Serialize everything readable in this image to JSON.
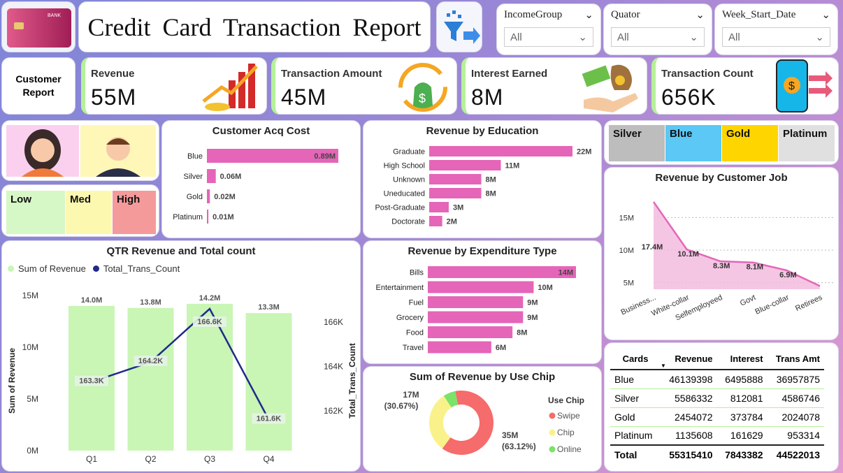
{
  "title": "Credit Card Transaction Report",
  "nav_label": "Customer Report",
  "slicers": [
    {
      "label": "IncomeGroup",
      "value": "All"
    },
    {
      "label": "Quator",
      "value": "All"
    },
    {
      "label": "Week_Start_Date",
      "value": "All"
    }
  ],
  "kpis": [
    {
      "label": "Revenue",
      "value": "55M"
    },
    {
      "label": "Transaction Amount",
      "value": "45M"
    },
    {
      "label": "Interest Earned",
      "value": "8M"
    },
    {
      "label": "Transaction Count",
      "value": "656K"
    }
  ],
  "tiers": [
    "Silver",
    "Blue",
    "Gold",
    "Platinum"
  ],
  "risk": [
    "Low",
    "Med",
    "High"
  ],
  "colors": {
    "pink": "#e565b8",
    "green": "#c9f5b5",
    "navy": "#1f2a8a",
    "silver": "#bdbdbd",
    "blue": "#5bc8f5",
    "gold": "#ffd500",
    "platinum": "#e0e0e0",
    "low": "#d6f7c6",
    "med": "#fdf8b0",
    "high": "#f59a9a"
  },
  "charts": {
    "acq": {
      "title": "Customer Acq Cost",
      "categories": [
        "Blue",
        "Silver",
        "Gold",
        "Platinum"
      ],
      "values": [
        0.89,
        0.06,
        0.02,
        0.01
      ],
      "labels": [
        "0.89M",
        "0.06M",
        "0.02M",
        "0.01M"
      ]
    },
    "edu": {
      "title": "Revenue by Education",
      "categories": [
        "Graduate",
        "High School",
        "Unknown",
        "Uneducated",
        "Post-Graduate",
        "Doctorate"
      ],
      "values": [
        22,
        11,
        8,
        8,
        3,
        2
      ],
      "labels": [
        "22M",
        "11M",
        "8M",
        "8M",
        "3M",
        "2M"
      ]
    },
    "exp": {
      "title": "Revenue by Expenditure Type",
      "categories": [
        "Bills",
        "Entertainment",
        "Fuel",
        "Grocery",
        "Food",
        "Travel"
      ],
      "values": [
        14,
        10,
        9,
        9,
        8,
        6
      ],
      "labels": [
        "14M",
        "10M",
        "9M",
        "9M",
        "8M",
        "6M"
      ]
    },
    "job": {
      "title": "Revenue by Customer Job",
      "categories": [
        "Business...",
        "White-collar",
        "Selfemployeed",
        "Govt",
        "Blue-collar",
        "Retirees"
      ],
      "values": [
        17.4,
        10.1,
        8.3,
        8.1,
        6.9,
        4.5
      ],
      "labels": [
        "17.4M",
        "10.1M",
        "8.3M",
        "8.1M",
        "6.9M",
        ""
      ],
      "yticks": [
        "15M",
        "10M",
        "5M"
      ]
    },
    "qtr": {
      "title": "QTR Revenue and Total count",
      "legend": [
        "Sum of Revenue",
        "Total_Trans_Count"
      ],
      "categories": [
        "Q1",
        "Q2",
        "Q3",
        "Q4"
      ],
      "revenue": [
        14.0,
        13.8,
        14.2,
        13.3
      ],
      "rev_labels": [
        "14.0M",
        "13.8M",
        "14.2M",
        "13.3M"
      ],
      "count": [
        163.3,
        164.2,
        166.6,
        161.6
      ],
      "count_labels": [
        "163.3K",
        "164.2K",
        "166.6K",
        "161.6K"
      ],
      "ylabel": "Sum of Revenue",
      "y2label": "Total_Trans_Count",
      "yticks": [
        "15M",
        "10M",
        "5M",
        "0M"
      ],
      "y2ticks": [
        "166K",
        "164K",
        "162K"
      ]
    },
    "chip": {
      "title": "Sum of Revenue by Use Chip",
      "legend_title": "Use Chip",
      "legend": [
        "Swipe",
        "Chip",
        "Online"
      ],
      "values": [
        63.12,
        30.67,
        6.21
      ],
      "colors": [
        "#f66b6b",
        "#f9f28a",
        "#7be26a"
      ],
      "label_swipe": [
        "35M",
        "(63.12%)"
      ],
      "label_chip": [
        "17M",
        "(30.67%)"
      ]
    }
  },
  "table": {
    "headers": [
      "Cards",
      "Revenue",
      "Interest",
      "Trans Amt"
    ],
    "rows": [
      [
        "Blue",
        "46139398",
        "6495888",
        "36957875"
      ],
      [
        "Silver",
        "5586332",
        "812081",
        "4586746"
      ],
      [
        "Gold",
        "2454072",
        "373784",
        "2024078"
      ],
      [
        "Platinum",
        "1135608",
        "161629",
        "953314"
      ]
    ],
    "total": [
      "Total",
      "55315410",
      "7843382",
      "44522013"
    ]
  }
}
